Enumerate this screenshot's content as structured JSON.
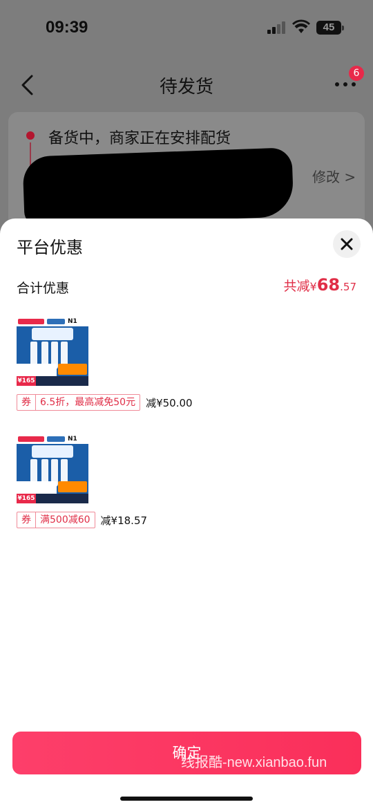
{
  "status_bar": {
    "time": "09:39",
    "battery": "45",
    "signal_icon": "cellular-signal-icon",
    "wifi_icon": "wifi-icon"
  },
  "nav": {
    "title": "待发货",
    "back_icon": "chevron-left-icon",
    "more_icon": "more-dots-icon",
    "more_badge": "6"
  },
  "order_status": {
    "text": "备货中，商家正在安排配货",
    "modify_label": "修改 >"
  },
  "sheet": {
    "title": "平台优惠",
    "close_icon": "close-icon",
    "total": {
      "label": "合计优惠",
      "prefix": "共减",
      "currency": "¥",
      "amount_int": "68",
      "amount_dec": ".57"
    },
    "items": [
      {
        "thumb_price": "¥165",
        "coupon_type": "券",
        "coupon_desc": "6.5折，最高减免50元",
        "saving": "减¥50.00"
      },
      {
        "thumb_price": "¥165",
        "coupon_type": "券",
        "coupon_desc": "满500减60",
        "saving": "减¥18.57"
      }
    ],
    "confirm_label": "确定",
    "watermark": "线报酷-new.xianbao.fun"
  },
  "colors": {
    "accent": "#e02e47",
    "button": "#fa2f5a"
  }
}
